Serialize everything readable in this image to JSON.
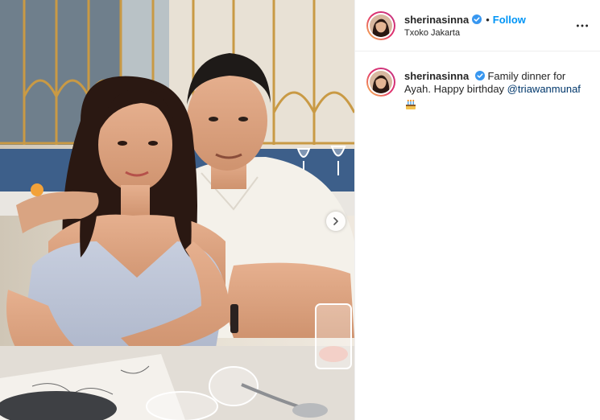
{
  "post": {
    "author": {
      "username": "sherinasinna",
      "verified": true,
      "follow_label": "Follow",
      "separator": "•",
      "location": "Txoko Jakarta"
    },
    "caption": {
      "username": "sherinasinna",
      "text_before": "Family dinner for Ayah. Happy birthday ",
      "mention": "@triawanmunaf",
      "emoji": "birthday-cake-emoji"
    }
  },
  "icons": {
    "verified": "verified-badge-icon",
    "more": "more-options-icon",
    "next": "chevron-right-icon"
  },
  "colors": {
    "follow": "#0095f6",
    "mention": "#00376b",
    "verified": "#3897f0"
  }
}
